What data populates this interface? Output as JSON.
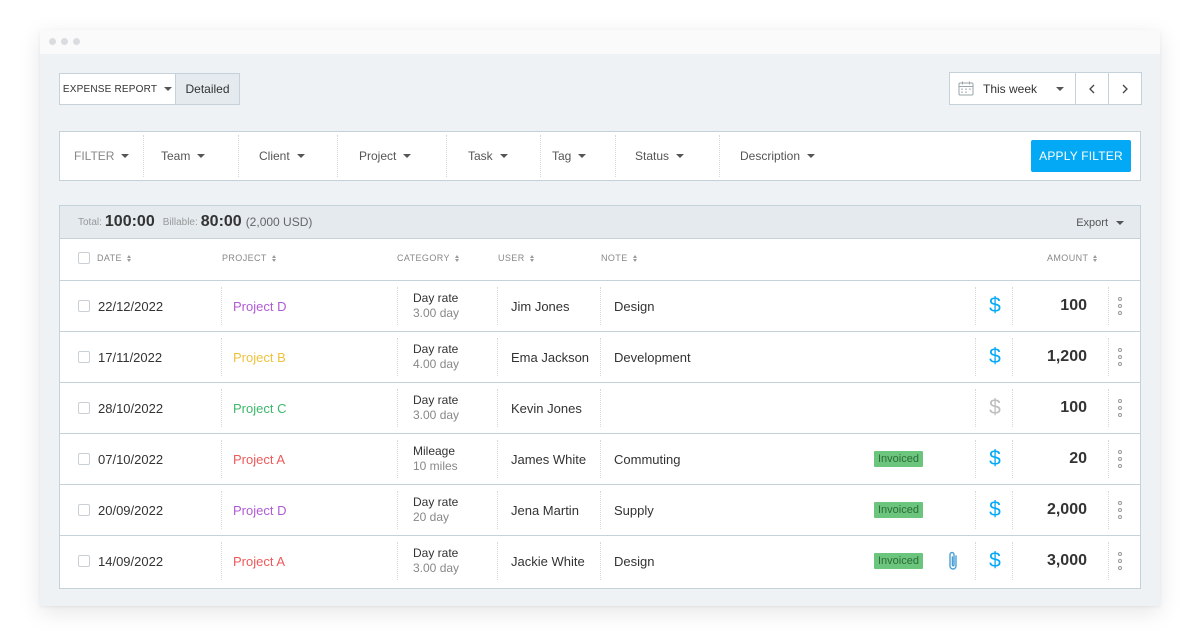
{
  "report_type": {
    "label": "EXPENSE REPORT",
    "detailed": "Detailed"
  },
  "date_range": {
    "label": "This week"
  },
  "filters": {
    "filter_label": "FILTER",
    "items": [
      "Team",
      "Client",
      "Project",
      "Task",
      "Tag",
      "Status",
      "Description"
    ],
    "apply_label": "APPLY FILTER"
  },
  "totals": {
    "total_label": "Total:",
    "total_value": "100:00",
    "billable_label": "Billable:",
    "billable_value": "80:00",
    "billable_amount": "(2,000 USD)",
    "export_label": "Export"
  },
  "columns": {
    "date": "DATE",
    "project": "PROJECT",
    "category": "CATEGORY",
    "user": "USER",
    "note": "NOTE",
    "amount": "AMOUNT"
  },
  "colors": {
    "accent": "#03a9f4",
    "dollar_billable": "#03a9f4",
    "dollar_nonbillable": "#bdbdbd",
    "badge_bg": "#6cc57d"
  },
  "rows": [
    {
      "date": "22/12/2022",
      "project": "Project D",
      "project_color": "#b05bd6",
      "category": "Day rate",
      "qty": "3.00 day",
      "user": "Jim Jones",
      "note": "Design",
      "badge": "",
      "attachment": false,
      "billable": true,
      "amount": "100"
    },
    {
      "date": "17/11/2022",
      "project": "Project B",
      "project_color": "#f0c23d",
      "category": "Day rate",
      "qty": "4.00 day",
      "user": "Ema Jackson",
      "note": "Development",
      "badge": "",
      "attachment": false,
      "billable": true,
      "amount": "1,200"
    },
    {
      "date": "28/10/2022",
      "project": "Project C",
      "project_color": "#3eb86a",
      "category": "Day rate",
      "qty": "3.00 day",
      "user": "Kevin Jones",
      "note": "",
      "badge": "",
      "attachment": false,
      "billable": false,
      "amount": "100"
    },
    {
      "date": "07/10/2022",
      "project": "Project A",
      "project_color": "#ee5a5a",
      "category": "Mileage",
      "qty": "10 miles",
      "user": "James White",
      "note": "Commuting",
      "badge": "Invoiced",
      "attachment": false,
      "billable": true,
      "amount": "20"
    },
    {
      "date": "20/09/2022",
      "project": "Project D",
      "project_color": "#b05bd6",
      "category": "Day rate",
      "qty": "20 day",
      "user": "Jena Martin",
      "note": "Supply",
      "badge": "Invoiced",
      "attachment": false,
      "billable": true,
      "amount": "2,000"
    },
    {
      "date": "14/09/2022",
      "project": "Project A",
      "project_color": "#ee5a5a",
      "category": "Day rate",
      "qty": "3.00 day",
      "user": "Jackie White",
      "note": "Design",
      "badge": "Invoiced",
      "attachment": true,
      "billable": true,
      "amount": "3,000"
    }
  ]
}
